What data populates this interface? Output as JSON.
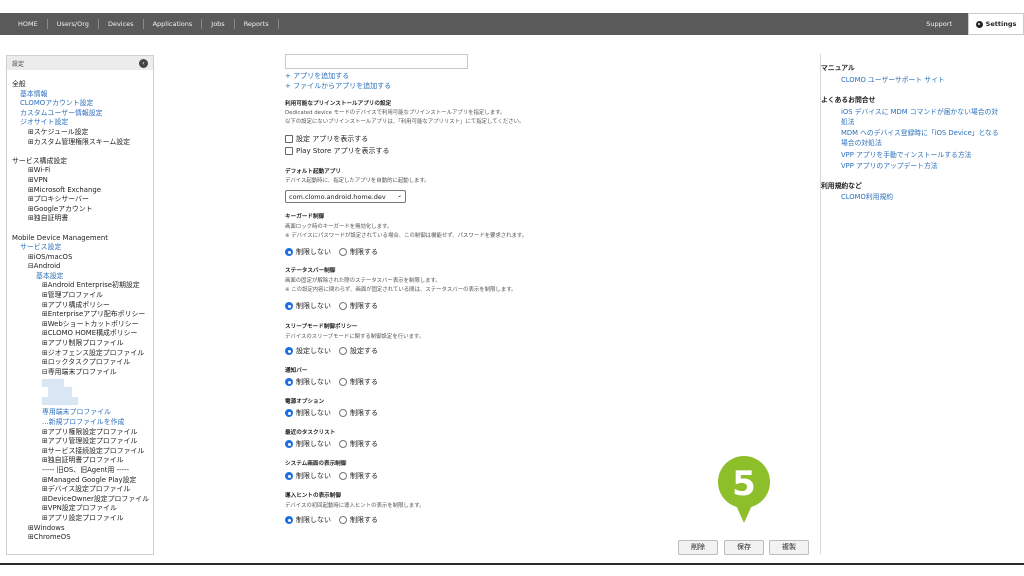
{
  "nav": {
    "items": [
      "HOME",
      "Users/Org",
      "Devices",
      "Applications",
      "Jobs",
      "Reports"
    ],
    "support": "Support",
    "settings": "Settings"
  },
  "sidebar": {
    "title": "設定",
    "items": [
      {
        "text": "全般",
        "k": "h",
        "i": 0
      },
      {
        "text": "基本情報",
        "k": "l",
        "i": 1
      },
      {
        "text": "CLOMOアカウント設定",
        "k": "l",
        "i": 1
      },
      {
        "text": "カスタムユーザー情報設定",
        "k": "l",
        "i": 1
      },
      {
        "text": "ジオサイト設定",
        "k": "l",
        "i": 1
      },
      {
        "text": "⊞スケジュール設定",
        "k": "d",
        "i": 2
      },
      {
        "text": "⊞カスタム管理権限スキーム設定",
        "k": "d",
        "i": 2
      },
      {
        "text": "",
        "k": "gap",
        "i": 0
      },
      {
        "text": "サービス構成設定",
        "k": "h",
        "i": 0
      },
      {
        "text": "⊞Wi-Fi",
        "k": "d",
        "i": 2
      },
      {
        "text": "⊞VPN",
        "k": "d",
        "i": 2
      },
      {
        "text": "⊞Microsoft Exchange",
        "k": "d",
        "i": 2
      },
      {
        "text": "⊞プロキシサーバー",
        "k": "d",
        "i": 2
      },
      {
        "text": "⊞Googleアカウント",
        "k": "d",
        "i": 2
      },
      {
        "text": "⊞独自証明書",
        "k": "d",
        "i": 2
      },
      {
        "text": "",
        "k": "gap",
        "i": 0
      },
      {
        "text": "Mobile Device Management",
        "k": "h",
        "i": 0
      },
      {
        "text": "サービス設定",
        "k": "l",
        "i": 1
      },
      {
        "text": "⊞iOS/macOS",
        "k": "d",
        "i": 2
      },
      {
        "text": "⊟Android",
        "k": "d",
        "i": 2
      },
      {
        "text": "基本設定",
        "k": "l",
        "i": 3
      },
      {
        "text": "⊞Android Enterprise初期設定",
        "k": "d",
        "i": 4
      },
      {
        "text": "⊞管理プロファイル",
        "k": "d",
        "i": 4
      },
      {
        "text": "⊞アプリ構成ポリシー",
        "k": "d",
        "i": 4
      },
      {
        "text": "⊞Enterpriseアプリ配布ポリシー",
        "k": "d",
        "i": 4
      },
      {
        "text": "⊞Webショートカットポリシー",
        "k": "d",
        "i": 4
      },
      {
        "text": "⊞CLOMO HOME構成ポリシー",
        "k": "d",
        "i": 4
      },
      {
        "text": "⊞アプリ制限プロファイル",
        "k": "d",
        "i": 4
      },
      {
        "text": "⊞ジオフェンス設定プロファイル",
        "k": "d",
        "i": 4
      },
      {
        "text": "⊞ロックタスクプロファイル",
        "k": "d",
        "i": 4
      },
      {
        "text": "⊟専用端末プロファイル",
        "k": "d",
        "i": 4
      },
      {
        "text": "",
        "k": "blur",
        "i": 0
      },
      {
        "text": "専用端末プロファイル",
        "k": "l",
        "i": 5
      },
      {
        "text": "...新規プロファイルを作成",
        "k": "l",
        "i": 5
      },
      {
        "text": "⊞アプリ権限設定プロファイル",
        "k": "d",
        "i": 4
      },
      {
        "text": "⊞アプリ管理設定プロファイル",
        "k": "d",
        "i": 4
      },
      {
        "text": "⊞サービス接続設定プロファイル",
        "k": "d",
        "i": 4
      },
      {
        "text": "⊞独自証明書プロファイル",
        "k": "d",
        "i": 4
      },
      {
        "text": "----- 旧OS、旧Agent用 -----",
        "k": "d",
        "i": 4
      },
      {
        "text": "⊞Managed Google Play設定",
        "k": "d",
        "i": 4
      },
      {
        "text": "⊞デバイス設定プロファイル",
        "k": "d",
        "i": 4
      },
      {
        "text": "⊞DeviceOwner設定プロファイル",
        "k": "d",
        "i": 4
      },
      {
        "text": "⊞VPN設定プロファイル",
        "k": "d",
        "i": 4
      },
      {
        "text": "⊞アプリ設定プロファイル",
        "k": "d",
        "i": 4
      },
      {
        "text": "⊞Windows",
        "k": "d",
        "i": 2
      },
      {
        "text": "⊞ChromeOS",
        "k": "d",
        "i": 2
      }
    ]
  },
  "main": {
    "add_app": "+ アプリを追加する",
    "add_file_app": "+ ファイルからアプリを追加する",
    "preinstall": {
      "title": "利用可能なプリインストールアプリの設定",
      "desc1": "Dedicated device モードのデバイスで利用可能なプリインストールアプリを指定します。",
      "desc2": "以下の設定にないプリインストールアプリは、「利用可能なアプリリスト」にて指定してください。",
      "cb1": "設定 アプリを表示する",
      "cb2": "Play Store アプリを表示する"
    },
    "default_app": {
      "title": "デフォルト起動アプリ",
      "desc": "デバイス起動時に、指定したアプリを自動的に起動します。",
      "value": "com.clomo.android.home.dev"
    },
    "keyguard": {
      "title": "キーガード制御",
      "desc1": "画面ロック時のキーガードを無効化します。",
      "desc2": "※ デバイスにパスワードが設定されている場合、この制御は機能せず、パスワードを要求されます。",
      "opt_no": "制限しない",
      "opt_yes": "制限する"
    },
    "statusbar": {
      "title": "ステータスバー制御",
      "desc1": "画面の固定が解除された際のステータスバー表示を制限します。",
      "desc2": "※ この設定内容に関わらず、画面が固定されている間は、ステータスバーの表示を制限します。",
      "opt_no": "制限しない",
      "opt_yes": "制限する"
    },
    "sleep": {
      "title": "スリープモード制御ポリシー",
      "desc": "デバイスのスリープモードに関する制御設定を行います。",
      "opt_no": "設定しない",
      "opt_yes": "設定する"
    },
    "notify": {
      "title": "通知バー",
      "opt_no": "制限しない",
      "opt_yes": "制限する"
    },
    "power": {
      "title": "電源オプション",
      "opt_no": "制限しない",
      "opt_yes": "制限する"
    },
    "recent": {
      "title": "最近のタスクリスト",
      "opt_no": "制限しない",
      "opt_yes": "制限する"
    },
    "sysdialog": {
      "title": "システム画面の表示制御",
      "opt_no": "制限しない",
      "opt_yes": "制限する"
    },
    "hints": {
      "title": "導入ヒントの表示制御",
      "desc": "デバイスの初回起動時に導入ヒントの表示を制限します。",
      "opt_no": "制限しない",
      "opt_yes": "制限する"
    }
  },
  "right": {
    "manual_head": "マニュアル",
    "manual_link": "CLOMO ユーザーサポート サイト",
    "faq_head": "よくあるお問合せ",
    "faq1a": "iOS デバイスに MDM コマンドが届かない場合の対",
    "faq1b": "処法",
    "faq2a": "MDM へのデバイス登録時に「iOS Device」となる",
    "faq2b": "場合の対処法",
    "faq3": "VPP アプリを手動でインストールする方法",
    "faq4": "VPP アプリのアップデート方法",
    "terms_head": "利用規約など",
    "terms_link": "CLOMO利用規約"
  },
  "actions": {
    "delete": "削除",
    "save": "保存",
    "copy": "複製"
  },
  "callout": {
    "number": "5",
    "color": "#8cbf2a"
  }
}
